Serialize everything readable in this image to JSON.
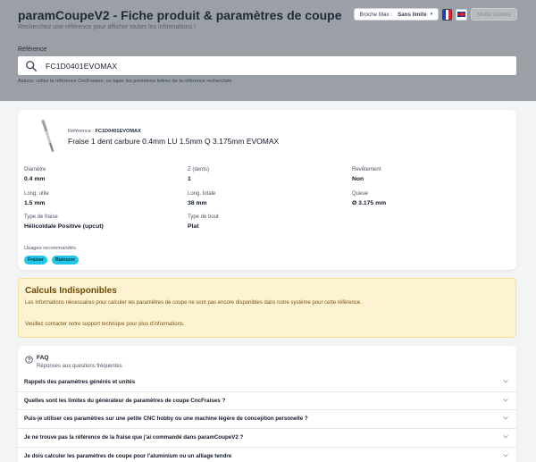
{
  "header": {
    "title": "paramCoupeV2 - Fiche produit & paramètres de coupe",
    "subtitle": "Recherchez une référence pour afficher toutes les informations !",
    "broche_label": "Broche Max :",
    "broche_value": "Sans limite",
    "mode_button": "Mode sombre"
  },
  "search": {
    "label": "Référence",
    "value": "FC1D0401EVOMAX",
    "hint": "Astuce: collez la référence CncFraises, ou taper les premières lettres de la référence recherchée."
  },
  "product": {
    "ref_label": "Référence :",
    "ref_value": "FC1D0401EVOMAX",
    "title": "Fraise 1 dent carbure 0.4mm LU 1.5mm Q 3.175mm EVOMAX",
    "specs": {
      "diametre": {
        "label": "Diamètre",
        "value": "0.4 mm"
      },
      "z_dents": {
        "label": "Z (dents)",
        "value": "1"
      },
      "revetement": {
        "label": "Revêtement",
        "value": "Non"
      },
      "long_utile": {
        "label": "Long. utile",
        "value": "1.5 mm"
      },
      "long_totale": {
        "label": "Long. totale",
        "value": "38 mm"
      },
      "queue": {
        "label": "Queue",
        "value": "Ø 3.175 mm"
      },
      "type_fraise": {
        "label": "Type de fraise",
        "value": "Hélicoïdale Positive (upcut)"
      },
      "type_bout": {
        "label": "Type de bout",
        "value": "Plat"
      }
    },
    "usages_label": "Usages recommandés",
    "usages": [
      "Fraiser",
      "Rainurer"
    ]
  },
  "warning": {
    "title": "Calculs Indisponibles",
    "line1": "Les informations nécessaires pour calculer les paramètres de coupe ne sont pas encore disponibles dans notre système pour cette référence.",
    "line2": "Veuillez contacter notre support technique pour plus d'informations."
  },
  "faq": {
    "title": "FAQ",
    "subtitle": "Réponses aux questions fréquentes",
    "items": [
      "Rappels des paramètres générés et unités",
      "Quelles sont les limites du générateur de paramètres de coupe CncFraises ?",
      "Puis-je utiliser ces paramètres sur une petite CNC hobby ou une machine légère de conception personelle ?",
      "Je ne trouve pas la référence de la fraise que j'ai commandé dans paramCoupeV2 ?",
      "Je dois calculer les paramètres de coupe pour l'aluminium ou un alliage tendre"
    ]
  },
  "colors": {
    "header_bg": "#9ba0a6",
    "page_bg": "#f3f4f6",
    "badge": "#22c7e8",
    "warning_bg": "#fdf3d2",
    "warning_text": "#6b4a07"
  },
  "icons": [
    "search-icon",
    "chevron-down-icon",
    "help-circle-icon",
    "flag-fr-icon",
    "flag-uk-icon"
  ]
}
